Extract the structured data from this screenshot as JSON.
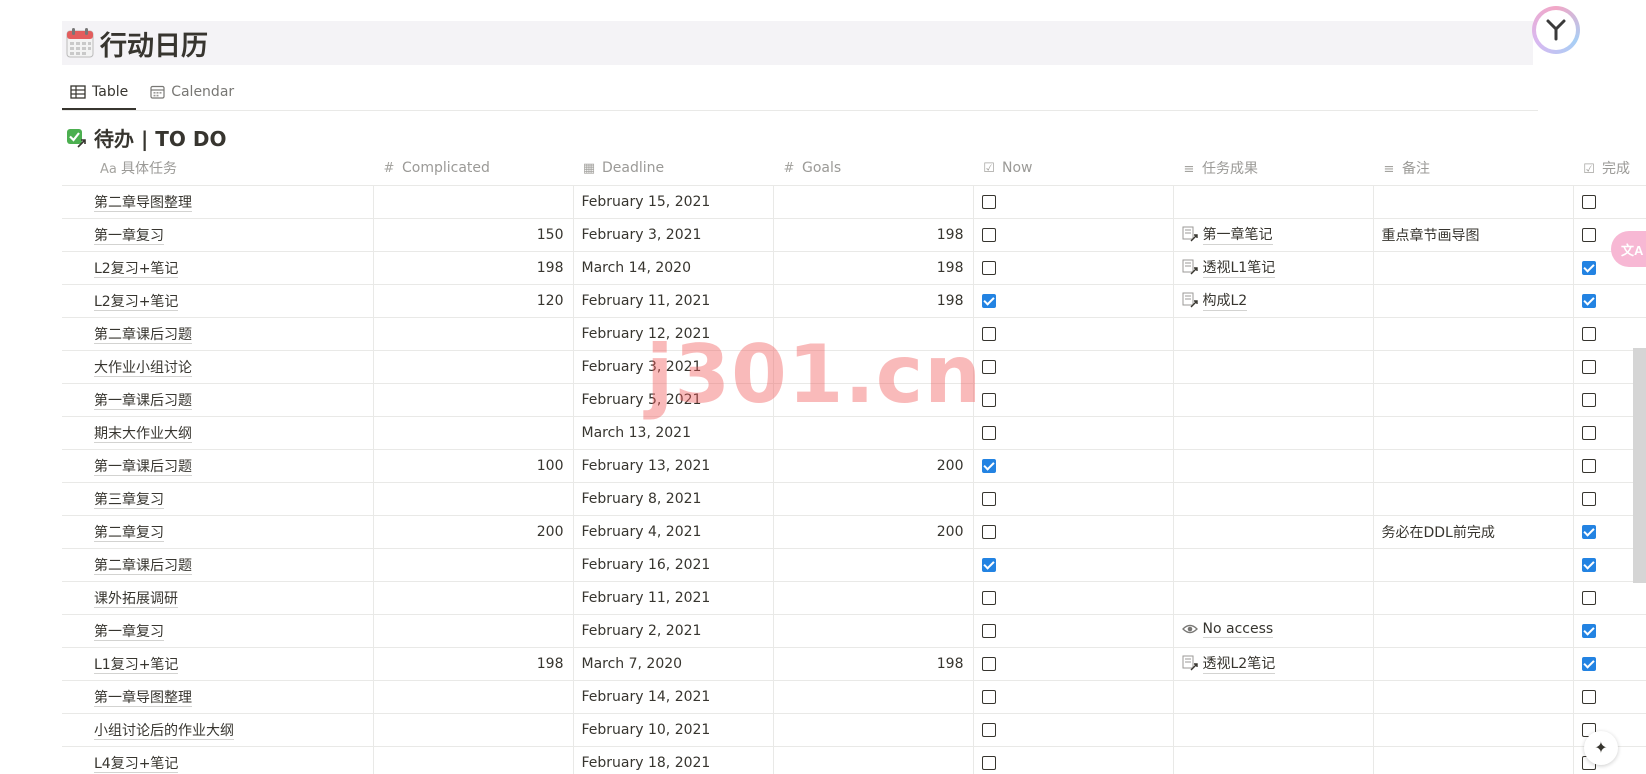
{
  "page": {
    "title": "行动日历",
    "icon": "calendar-emoji-icon"
  },
  "tabs": [
    {
      "label": "Table",
      "icon": "table-icon",
      "active": true
    },
    {
      "label": "Calendar",
      "icon": "calendar-icon",
      "active": false
    }
  ],
  "section": {
    "title": "待办 | TO DO",
    "icon": "checkmark-box-link-icon"
  },
  "columns": [
    {
      "label": "具体任务",
      "icon": "Aa"
    },
    {
      "label": "Complicated",
      "icon": "#"
    },
    {
      "label": "Deadline",
      "icon": "calendar-icon"
    },
    {
      "label": "Goals",
      "icon": "#"
    },
    {
      "label": "Now",
      "icon": "checkbox-icon"
    },
    {
      "label": "任务成果",
      "icon": "text-lines-icon"
    },
    {
      "label": "备注",
      "icon": "text-lines-icon"
    },
    {
      "label": "完成",
      "icon": "checkbox-icon"
    }
  ],
  "rows": [
    {
      "task": "第二章导图整理",
      "complicated": "",
      "deadline": "February 15, 2021",
      "goals": "",
      "now": false,
      "result": "",
      "result_icon": "",
      "note": "",
      "done": false
    },
    {
      "task": "第一章复习",
      "complicated": "150",
      "deadline": "February 3, 2021",
      "goals": "198",
      "now": false,
      "result": "第一章笔记",
      "result_icon": "page-link-icon",
      "note": "重点章节画导图",
      "done": false
    },
    {
      "task": "L2复习+笔记",
      "complicated": "198",
      "deadline": "March 14, 2020",
      "goals": "198",
      "now": false,
      "result": "透视L1笔记",
      "result_icon": "page-link-icon",
      "note": "",
      "done": true
    },
    {
      "task": "L2复习+笔记",
      "complicated": "120",
      "deadline": "February 11, 2021",
      "goals": "198",
      "now": true,
      "result": "构成L2",
      "result_icon": "page-link-icon",
      "note": "",
      "done": true
    },
    {
      "task": "第二章课后习题",
      "complicated": "",
      "deadline": "February 12, 2021",
      "goals": "",
      "now": false,
      "result": "",
      "result_icon": "",
      "note": "",
      "done": false
    },
    {
      "task": "大作业小组讨论",
      "complicated": "",
      "deadline": "February 3, 2021",
      "goals": "",
      "now": false,
      "result": "",
      "result_icon": "",
      "note": "",
      "done": false
    },
    {
      "task": "第一章课后习题",
      "complicated": "",
      "deadline": "February 5, 2021",
      "goals": "",
      "now": false,
      "result": "",
      "result_icon": "",
      "note": "",
      "done": false
    },
    {
      "task": "期末大作业大纲",
      "complicated": "",
      "deadline": "March 13, 2021",
      "goals": "",
      "now": false,
      "result": "",
      "result_icon": "",
      "note": "",
      "done": false
    },
    {
      "task": "第一章课后习题",
      "complicated": "100",
      "deadline": "February 13, 2021",
      "goals": "200",
      "now": true,
      "result": "",
      "result_icon": "",
      "note": "",
      "done": false
    },
    {
      "task": "第三章复习",
      "complicated": "",
      "deadline": "February 8, 2021",
      "goals": "",
      "now": false,
      "result": "",
      "result_icon": "",
      "note": "",
      "done": false
    },
    {
      "task": "第二章复习",
      "complicated": "200",
      "deadline": "February 4, 2021",
      "goals": "200",
      "now": false,
      "result": "",
      "result_icon": "",
      "note": "务必在DDL前完成",
      "done": true
    },
    {
      "task": "第二章课后习题",
      "complicated": "",
      "deadline": "February 16, 2021",
      "goals": "",
      "now": true,
      "result": "",
      "result_icon": "",
      "note": "",
      "done": true
    },
    {
      "task": "课外拓展调研",
      "complicated": "",
      "deadline": "February 11, 2021",
      "goals": "",
      "now": false,
      "result": "",
      "result_icon": "",
      "note": "",
      "done": false
    },
    {
      "task": "第一章复习",
      "complicated": "",
      "deadline": "February 2, 2021",
      "goals": "",
      "now": false,
      "result": "No access",
      "result_icon": "eye-icon",
      "note": "",
      "done": true
    },
    {
      "task": "L1复习+笔记",
      "complicated": "198",
      "deadline": "March 7, 2020",
      "goals": "198",
      "now": false,
      "result": "透视L2笔记",
      "result_icon": "page-link-icon",
      "note": "",
      "done": true
    },
    {
      "task": "第一章导图整理",
      "complicated": "",
      "deadline": "February 14, 2021",
      "goals": "",
      "now": false,
      "result": "",
      "result_icon": "",
      "note": "",
      "done": false
    },
    {
      "task": "小组讨论后的作业大纲",
      "complicated": "",
      "deadline": "February 10, 2021",
      "goals": "",
      "now": false,
      "result": "",
      "result_icon": "",
      "note": "",
      "done": false
    },
    {
      "task": "L4复习+笔记",
      "complicated": "",
      "deadline": "February 18, 2021",
      "goals": "",
      "now": false,
      "result": "",
      "result_icon": "",
      "note": "",
      "done": false
    }
  ],
  "watermark": "j301.cn",
  "translate_badge": "文A",
  "colors": {
    "accent": "#2383e2",
    "watermark": "#f05a5a"
  }
}
